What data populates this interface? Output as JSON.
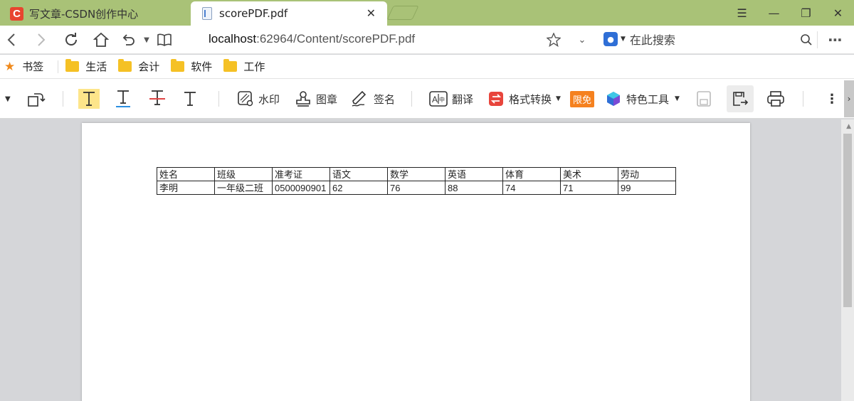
{
  "tabs": [
    {
      "title": "写文章-CSDN创作中心",
      "icon": "csdn-logo",
      "active": false
    },
    {
      "title": "scorePDF.pdf",
      "icon": "pdf-file-icon",
      "active": true
    }
  ],
  "csdn_logo_letter": "C",
  "address": {
    "host": "localhost",
    "rest": ":62964/Content/scorePDF.pdf",
    "search_placeholder": "在此搜索"
  },
  "bookmarks": {
    "label": "书签",
    "folders": [
      "生活",
      "会计",
      "软件",
      "工作"
    ]
  },
  "pdf_toolbar": {
    "watermark": "水印",
    "stamp": "图章",
    "signature": "签名",
    "translate": "翻译",
    "format_convert": "格式转换",
    "limited_free": "限免",
    "special_tools": "特色工具"
  },
  "table": {
    "headers": [
      "姓名",
      "班级",
      "准考证",
      "语文",
      "数学",
      "英语",
      "体育",
      "美术",
      "劳动"
    ],
    "rows": [
      [
        "李明",
        "一年级二班",
        "0500090901",
        "62",
        "76",
        "88",
        "74",
        "71",
        "99"
      ]
    ]
  },
  "colors": {
    "tab_bar": "#a9c277",
    "csdn": "#e8452f",
    "bookmark_star": "#f08a1c",
    "folder": "#f5c125",
    "badge": "#f5811f",
    "highlight": "#fde58a"
  }
}
